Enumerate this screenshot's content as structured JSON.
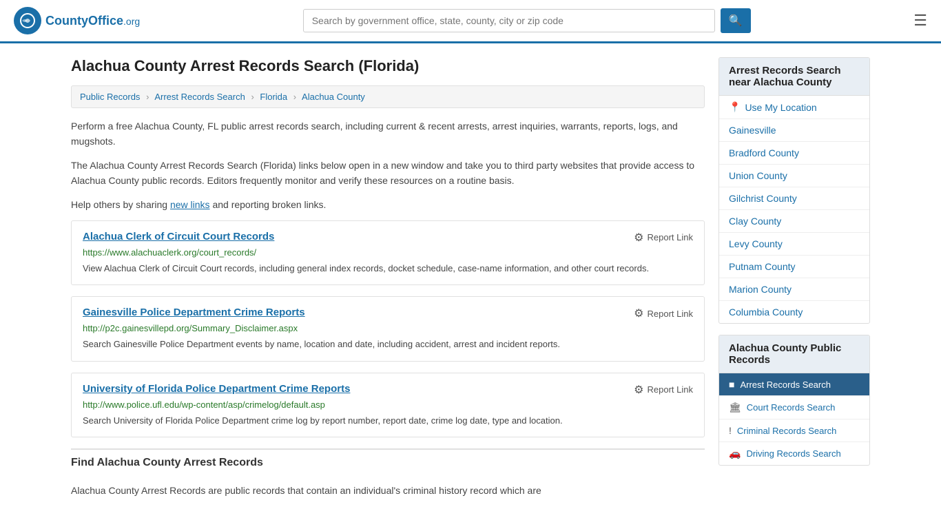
{
  "header": {
    "logo_text": "CountyOffice",
    "logo_org": ".org",
    "search_placeholder": "Search by government office, state, county, city or zip code",
    "search_value": ""
  },
  "page": {
    "title": "Alachua County Arrest Records Search (Florida)",
    "breadcrumb": [
      {
        "label": "Public Records",
        "href": "#"
      },
      {
        "label": "Arrest Records Search",
        "href": "#"
      },
      {
        "label": "Florida",
        "href": "#"
      },
      {
        "label": "Alachua County",
        "href": "#"
      }
    ],
    "intro1": "Perform a free Alachua County, FL public arrest records search, including current & recent arrests, arrest inquiries, warrants, reports, logs, and mugshots.",
    "intro2": "The Alachua County Arrest Records Search (Florida) links below open in a new window and take you to third party websites that provide access to Alachua County public records. Editors frequently monitor and verify these resources on a routine basis.",
    "intro3_pre": "Help others by sharing ",
    "intro3_link": "new links",
    "intro3_post": " and reporting broken links."
  },
  "records": [
    {
      "title": "Alachua Clerk of Circuit Court Records",
      "url": "https://www.alachuaclerk.org/court_records/",
      "description": "View Alachua Clerk of Circuit Court records, including general index records, docket schedule, case-name information, and other court records.",
      "report_label": "Report Link"
    },
    {
      "title": "Gainesville Police Department Crime Reports",
      "url": "http://p2c.gainesvillepd.org/Summary_Disclaimer.aspx",
      "description": "Search Gainesville Police Department events by name, location and date, including accident, arrest and incident reports.",
      "report_label": "Report Link"
    },
    {
      "title": "University of Florida Police Department Crime Reports",
      "url": "http://www.police.ufl.edu/wp-content/asp/crimelog/default.asp",
      "description": "Search University of Florida Police Department crime log by report number, report date, crime log date, type and location.",
      "report_label": "Report Link"
    }
  ],
  "find_section": {
    "heading": "Find Alachua County Arrest Records",
    "text": "Alachua County Arrest Records are public records that contain an individual's criminal history record which are"
  },
  "sidebar": {
    "nearby_title": "Arrest Records Search near Alachua County",
    "use_location": "Use My Location",
    "nearby_links": [
      "Gainesville",
      "Bradford County",
      "Union County",
      "Gilchrist County",
      "Clay County",
      "Levy County",
      "Putnam County",
      "Marion County",
      "Columbia County"
    ],
    "public_records_title": "Alachua County Public Records",
    "public_records_items": [
      {
        "label": "Arrest Records Search",
        "icon": "■",
        "active": true
      },
      {
        "label": "Court Records Search",
        "icon": "🏛",
        "active": false
      },
      {
        "label": "Criminal Records Search",
        "icon": "!",
        "active": false
      },
      {
        "label": "Driving Records Search",
        "icon": "🚗",
        "active": false
      }
    ]
  }
}
